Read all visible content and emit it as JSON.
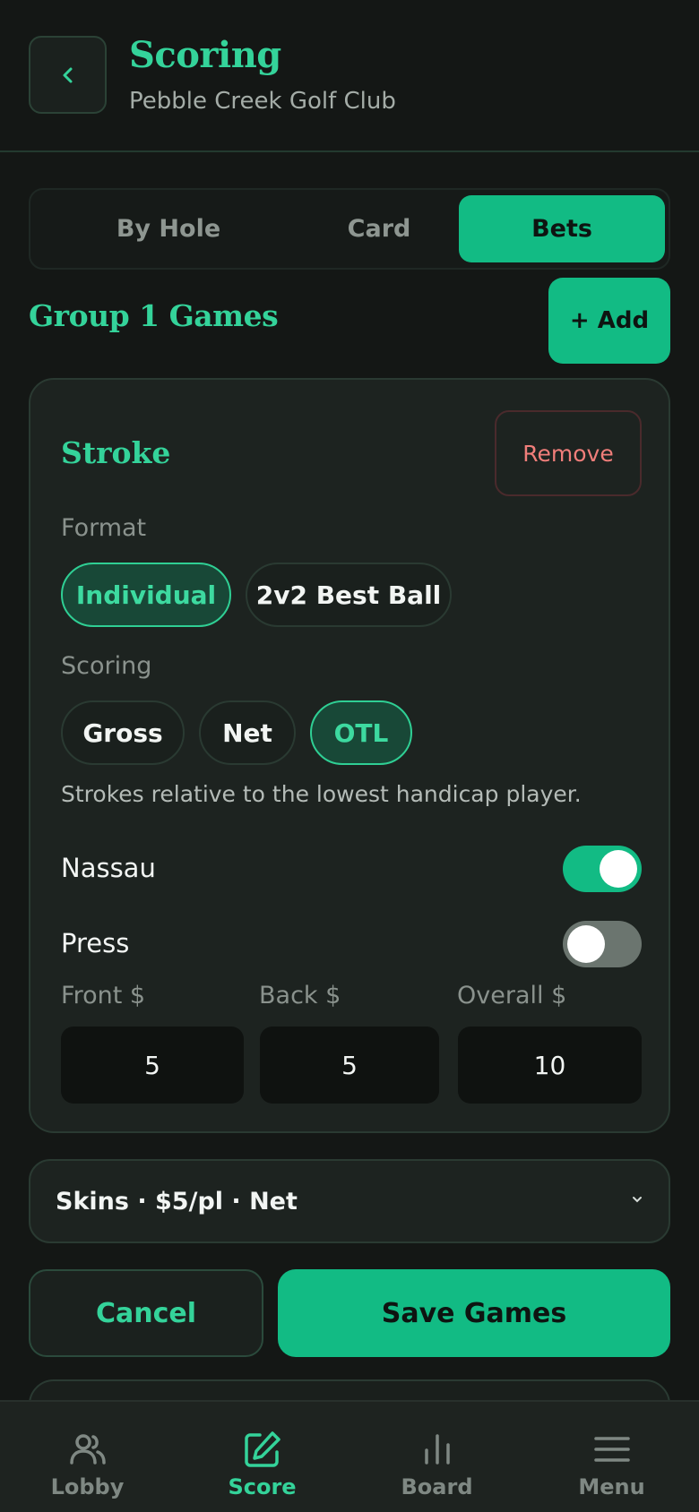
{
  "header": {
    "title": "Scoring",
    "subtitle": "Pebble Creek Golf Club",
    "back_icon": "chevron-left-icon"
  },
  "tabs": [
    {
      "label": "By Hole",
      "active": false
    },
    {
      "label": "Card",
      "active": false
    },
    {
      "label": "Bets",
      "active": true
    }
  ],
  "group": {
    "title": "Group 1 Games",
    "add_label": "+ Add"
  },
  "game_card": {
    "title": "Stroke",
    "remove_label": "Remove",
    "format_label": "Format",
    "format_options": [
      {
        "label": "Individual",
        "selected": true
      },
      {
        "label": "2v2 Best Ball",
        "selected": false
      }
    ],
    "scoring_label": "Scoring",
    "scoring_options": [
      {
        "label": "Gross",
        "selected": false
      },
      {
        "label": "Net",
        "selected": false
      },
      {
        "label": "OTL",
        "selected": true
      }
    ],
    "scoring_hint": "Strokes relative to the lowest handicap player.",
    "nassau": {
      "label": "Nassau",
      "on": true
    },
    "press": {
      "label": "Press",
      "on": false
    },
    "amounts": [
      {
        "label": "Front $",
        "value": "5"
      },
      {
        "label": "Back $",
        "value": "5"
      },
      {
        "label": "Overall $",
        "value": "10"
      }
    ]
  },
  "skins_row": {
    "label": "Skins · $5/pl · Net",
    "chevron_icon": "chevron-down-icon"
  },
  "actions": {
    "cancel_label": "Cancel",
    "save_label": "Save Games"
  },
  "bottom_nav": [
    {
      "label": "Lobby",
      "icon": "users-icon",
      "active": false
    },
    {
      "label": "Score",
      "icon": "edit-icon",
      "active": true
    },
    {
      "label": "Board",
      "icon": "bar-chart-icon",
      "active": false
    },
    {
      "label": "Menu",
      "icon": "menu-icon",
      "active": false
    }
  ],
  "colors": {
    "accent": "#12bb84",
    "accent_text": "#34d39a",
    "background": "#141715",
    "danger": "#f07e7a"
  }
}
